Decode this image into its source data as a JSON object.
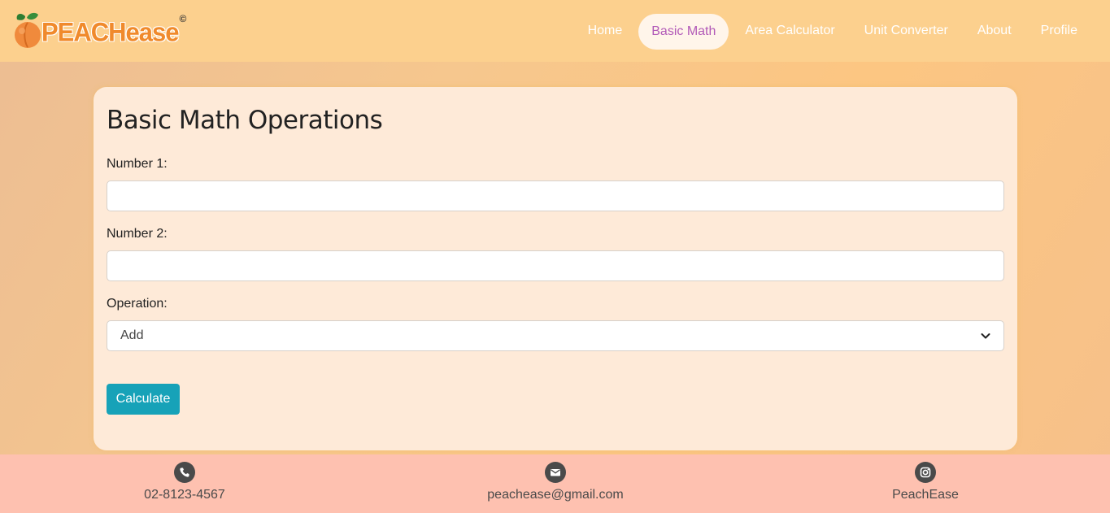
{
  "brand": {
    "name": "PEACHease",
    "copyright": "©"
  },
  "nav": {
    "items": [
      {
        "label": "Home",
        "active": false
      },
      {
        "label": "Basic Math",
        "active": true
      },
      {
        "label": "Area Calculator",
        "active": false
      },
      {
        "label": "Unit Converter",
        "active": false
      },
      {
        "label": "About",
        "active": false
      },
      {
        "label": "Profile",
        "active": false
      }
    ]
  },
  "form": {
    "title": "Basic Math Operations",
    "number1_label": "Number 1:",
    "number1_value": "",
    "number2_label": "Number 2:",
    "number2_value": "",
    "operation_label": "Operation:",
    "operation_selected": "Add",
    "submit_label": "Calculate"
  },
  "footer": {
    "phone": {
      "icon": "phone-icon",
      "text": "02-8123-4567"
    },
    "email": {
      "icon": "mail-icon",
      "text": "peachease@gmail.com"
    },
    "instagram": {
      "icon": "instagram-icon",
      "text": "PeachEase"
    }
  },
  "colors": {
    "nav_bg": "#fcd08e",
    "card_bg": "#feead8",
    "button_bg": "#17a2b8",
    "footer_bg": "#fec1b0",
    "active_nav_text": "#b25ab8",
    "brand_orange": "#f08a2c"
  }
}
